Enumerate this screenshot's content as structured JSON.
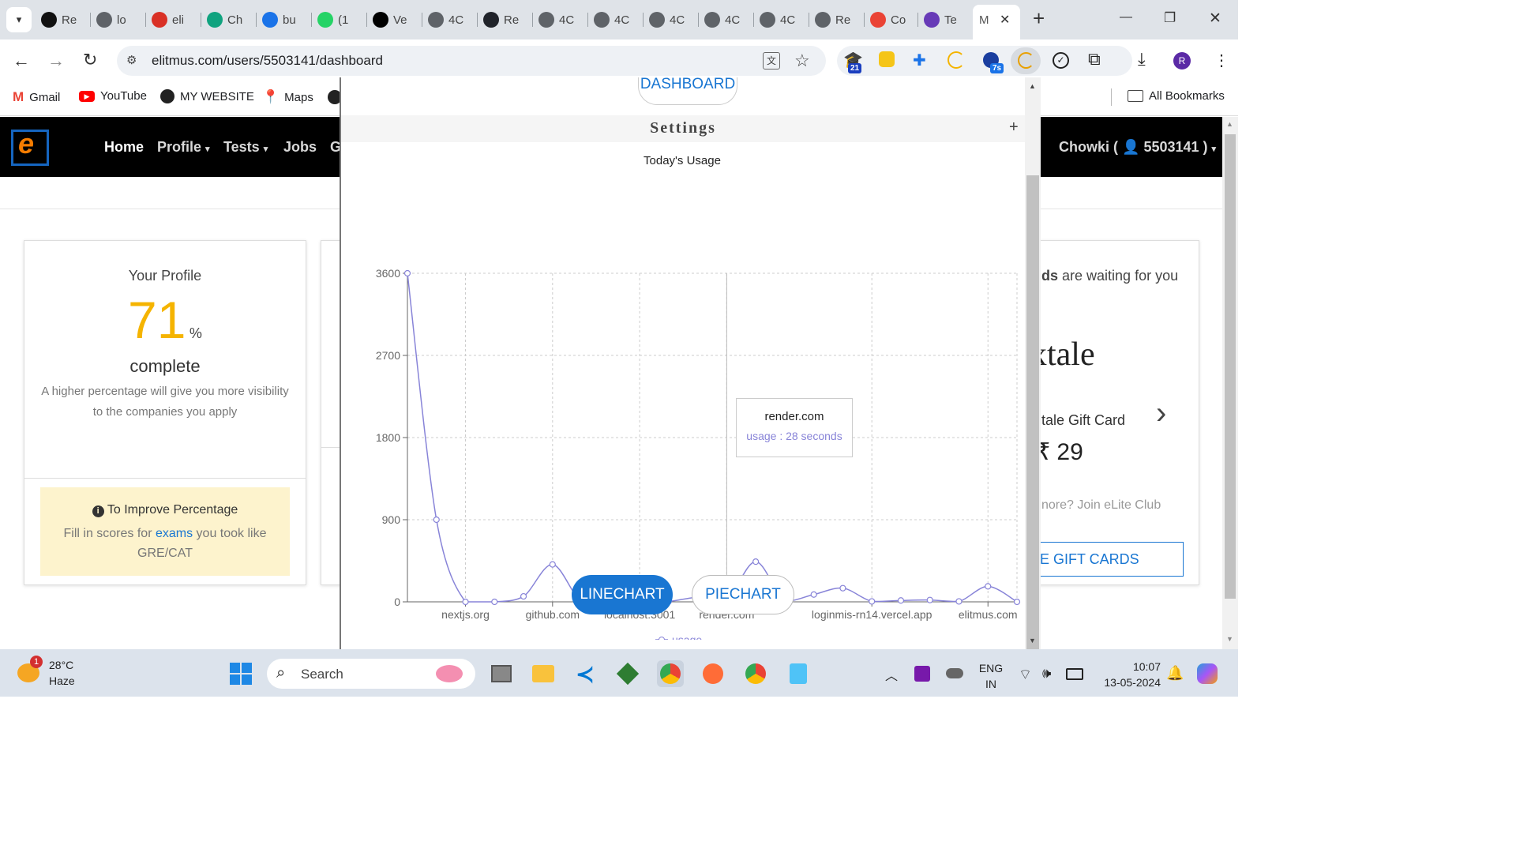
{
  "browser": {
    "tabs": [
      {
        "label": "Re",
        "icon": "github-icon",
        "color": "#111111"
      },
      {
        "label": "lo",
        "icon": "globe-icon",
        "color": "#5f6368"
      },
      {
        "label": "eli",
        "icon": "elitmus-icon",
        "color": "#d93025"
      },
      {
        "label": "Ch",
        "icon": "chatgpt-icon",
        "color": "#10a37f"
      },
      {
        "label": "bu",
        "icon": "drive-icon",
        "color": "#1a73e8"
      },
      {
        "label": "(1",
        "icon": "whatsapp-icon",
        "color": "#25d366"
      },
      {
        "label": "Ve",
        "icon": "vercel-icon",
        "color": "#000000"
      },
      {
        "label": "4C",
        "icon": "globe-icon",
        "color": "#5f6368"
      },
      {
        "label": "Re",
        "icon": "react-icon",
        "color": "#20232a"
      },
      {
        "label": "4C",
        "icon": "globe-icon",
        "color": "#5f6368"
      },
      {
        "label": "4C",
        "icon": "globe-icon",
        "color": "#5f6368"
      },
      {
        "label": "4C",
        "icon": "globe-icon",
        "color": "#5f6368"
      },
      {
        "label": "4C",
        "icon": "globe-icon",
        "color": "#5f6368"
      },
      {
        "label": "4C",
        "icon": "globe-icon",
        "color": "#5f6368"
      },
      {
        "label": "Re",
        "icon": "globe-icon",
        "color": "#5f6368"
      },
      {
        "label": "Co",
        "icon": "gmail-icon",
        "color": "#ea4335"
      },
      {
        "label": "Te",
        "icon": "forms-icon",
        "color": "#673ab7"
      }
    ],
    "active_tab": {
      "label": "M",
      "close": "✕"
    },
    "new_tab": "+",
    "window": {
      "minimize": "—",
      "restore": "❐",
      "close": "✕"
    },
    "url": "elitmus.com/users/5503141/dashboard",
    "ext_badges": {
      "first": "21",
      "second": "7s"
    },
    "profile_letter": "R",
    "bookmarks": [
      {
        "label": "Gmail",
        "icon": "gmail-icon"
      },
      {
        "label": "YouTube",
        "icon": "youtube-icon"
      },
      {
        "label": "MY WEBSITE",
        "icon": "globe-icon"
      },
      {
        "label": "Maps",
        "icon": "maps-icon"
      }
    ],
    "all_bookmarks": "All Bookmarks"
  },
  "site": {
    "logo": "e",
    "nav": [
      "Home",
      "Profile",
      "Tests",
      "Jobs",
      "G"
    ],
    "user": "Chowki ( ",
    "user_id": "5503141 )"
  },
  "profile_card": {
    "title": "Your Profile",
    "percent": "71",
    "percent_sign": "%",
    "complete": "complete",
    "desc": "A higher percentage will give you more visibility to the companies you apply",
    "tip_title": "To Improve Percentage",
    "tip_text_before": "Fill in scores for ",
    "tip_link": "exams",
    "tip_text_after": " you took like GRE/CAT"
  },
  "rewards_card": {
    "waiting_bold": "ds",
    "waiting": " are waiting for you",
    "brand": "xtale",
    "gift": "tale Gift Card",
    "price": "₹ 29",
    "club": "nore? Join eLite Club",
    "button": "E GIFT CARDS"
  },
  "modal": {
    "dashboard": "DASHBOARD",
    "settings": "Settings",
    "settings_toggle": "+",
    "chart_title": "Today's Usage",
    "legend": "usage",
    "tooltip_title": "render.com",
    "tooltip_value": "usage : 28 seconds",
    "btn_line": "LINECHART",
    "btn_pie": "PIECHART"
  },
  "chart_data": {
    "type": "line",
    "title": "Today's Usage",
    "series": [
      {
        "name": "usage",
        "values": [
          3600,
          900,
          0,
          0,
          60,
          410,
          0,
          20,
          5,
          5,
          50,
          28,
          440,
          10,
          80,
          150,
          5,
          15,
          20,
          5,
          170,
          0
        ]
      }
    ],
    "x_tick_labels": [
      "nextjs.org",
      "github.com",
      "localhost:3001",
      "render.com",
      "loginmis-rn14.vercel.app",
      "elitmus.com"
    ],
    "x_tick_indices": [
      2,
      5,
      8,
      11,
      16,
      20
    ],
    "y_ticks": [
      0,
      900,
      1800,
      2700,
      3600
    ],
    "ylim": [
      0,
      3600
    ],
    "grid": true,
    "legend": "bottom",
    "highlight_index": 11,
    "line_color": "#8884d8"
  },
  "taskbar": {
    "weather_temp": "28°C",
    "weather_desc": "Haze",
    "notif_count": "1",
    "search": "Search",
    "lang1": "ENG",
    "lang2": "IN",
    "time": "10:07",
    "date": "13-05-2024"
  }
}
